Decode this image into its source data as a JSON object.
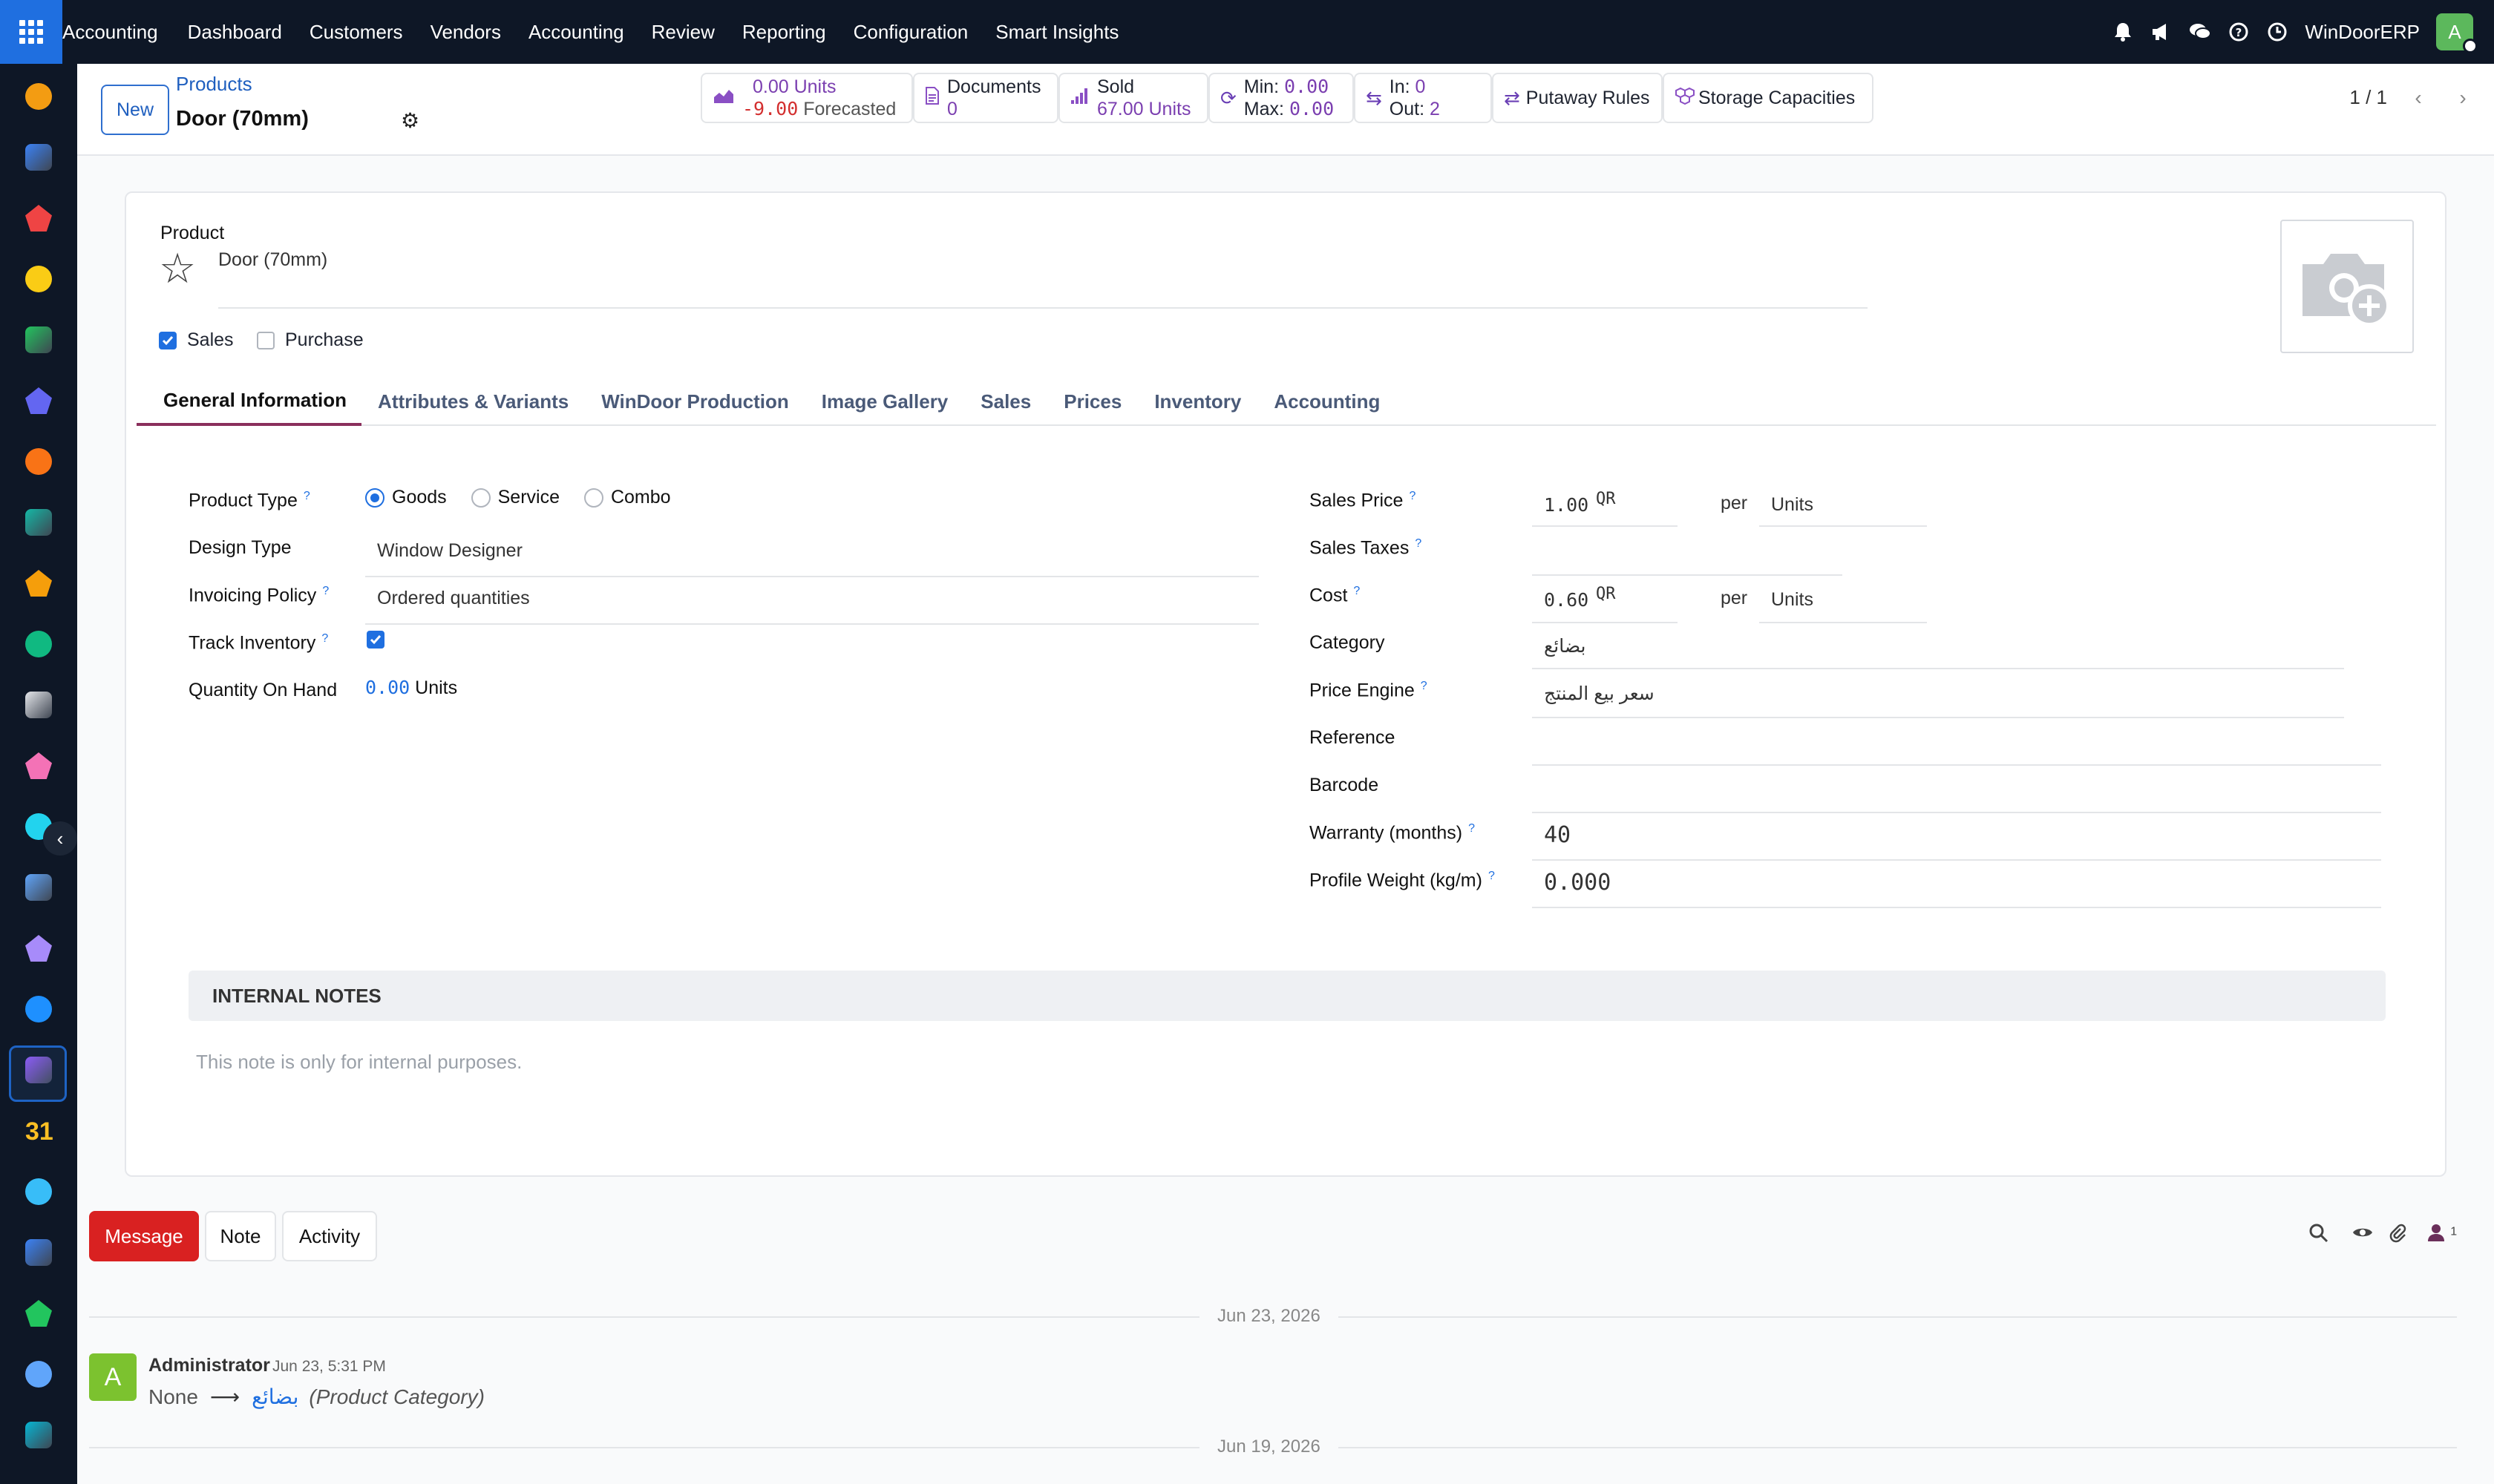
{
  "topbar": {
    "brand": "Accounting",
    "menu": [
      "Dashboard",
      "Customers",
      "Vendors",
      "Accounting",
      "Review",
      "Reporting",
      "Configuration",
      "Smart Insights"
    ],
    "company": "WinDoorERP",
    "user_initial": "A"
  },
  "sidebar": {
    "apps": [
      "bar-chart",
      "dial",
      "pie",
      "telegram",
      "whatsapp",
      "mail",
      "chat",
      "check",
      "bar-chart-2",
      "id-card",
      "cube",
      "palette",
      "checkmark",
      "book",
      "box",
      "invoice",
      "team",
      "calendar-31",
      "pen",
      "dashboard",
      "whatsapp-2",
      "dial-2",
      "sync"
    ],
    "calendar_day": "31"
  },
  "control": {
    "new_label": "New",
    "breadcrumb": "Products",
    "title": "Door (70mm)",
    "smart_buttons": {
      "forecast_units": "0.00 Units",
      "forecast_value": "-9.00",
      "forecast_label": "Forecasted",
      "documents_label": "Documents",
      "documents_count": "0",
      "sold_label": "Sold",
      "sold_value": "67.00 Units",
      "min_label": "Min:",
      "min_value": "0.00",
      "max_label": "Max:",
      "max_value": "0.00",
      "in_label": "In:",
      "in_value": "0",
      "out_label": "Out:",
      "out_value": "2",
      "putaway_label": "Putaway Rules",
      "storage_label": "Storage Capacities"
    },
    "pager": "1 / 1"
  },
  "form": {
    "product_label": "Product",
    "product_name": "Door (70mm)",
    "sales_label": "Sales",
    "sales_checked": true,
    "purchase_label": "Purchase",
    "purchase_checked": false,
    "tabs": [
      "General Information",
      "Attributes & Variants",
      "WinDoor Production",
      "Image Gallery",
      "Sales",
      "Prices",
      "Inventory",
      "Accounting"
    ],
    "active_tab": "General Information",
    "left": {
      "product_type_label": "Product Type",
      "product_type_options": [
        "Goods",
        "Service",
        "Combo"
      ],
      "product_type_selected": "Goods",
      "design_type_label": "Design Type",
      "design_type_value": "Window Designer",
      "invoicing_policy_label": "Invoicing Policy",
      "invoicing_policy_value": "Ordered quantities",
      "track_inventory_label": "Track Inventory",
      "track_inventory_checked": true,
      "qty_on_hand_label": "Quantity On Hand",
      "qty_on_hand_value": "0.00",
      "qty_on_hand_unit": "Units"
    },
    "right": {
      "sales_price_label": "Sales Price",
      "sales_price_value": "1.00",
      "sales_price_currency": "QR",
      "per_label": "per",
      "sales_price_uom": "Units",
      "sales_taxes_label": "Sales Taxes",
      "sales_taxes_value": "",
      "cost_label": "Cost",
      "cost_value": "0.60",
      "cost_currency": "QR",
      "cost_uom": "Units",
      "category_label": "Category",
      "category_value": "بضائع",
      "price_engine_label": "Price Engine",
      "price_engine_value": "سعر بيع المنتج",
      "reference_label": "Reference",
      "reference_value": "",
      "barcode_label": "Barcode",
      "barcode_value": "",
      "warranty_label": "Warranty (months)",
      "warranty_value": "40",
      "profile_weight_label": "Profile Weight (kg/m)",
      "profile_weight_value": "0.000"
    },
    "internal_notes_header": "INTERNAL NOTES",
    "internal_notes_placeholder": "This note is only for internal purposes."
  },
  "chatter": {
    "message_label": "Message",
    "note_label": "Note",
    "activity_label": "Activity",
    "followers_count": "1",
    "date_1": "Jun 23, 2026",
    "date_2": "Jun 19, 2026",
    "message": {
      "author": "Administrator",
      "time": "Jun 23, 5:31 PM",
      "avatar_initial": "A",
      "old_value": "None",
      "new_value": "بضائع",
      "field": "(Product Category)"
    }
  },
  "colors": {
    "topbar": "#0e1726",
    "accent": "#1f6fe0",
    "message_button": "#d92121",
    "active_tab_underline": "#8a2f5c",
    "smart_value": "#7b3fb0"
  }
}
